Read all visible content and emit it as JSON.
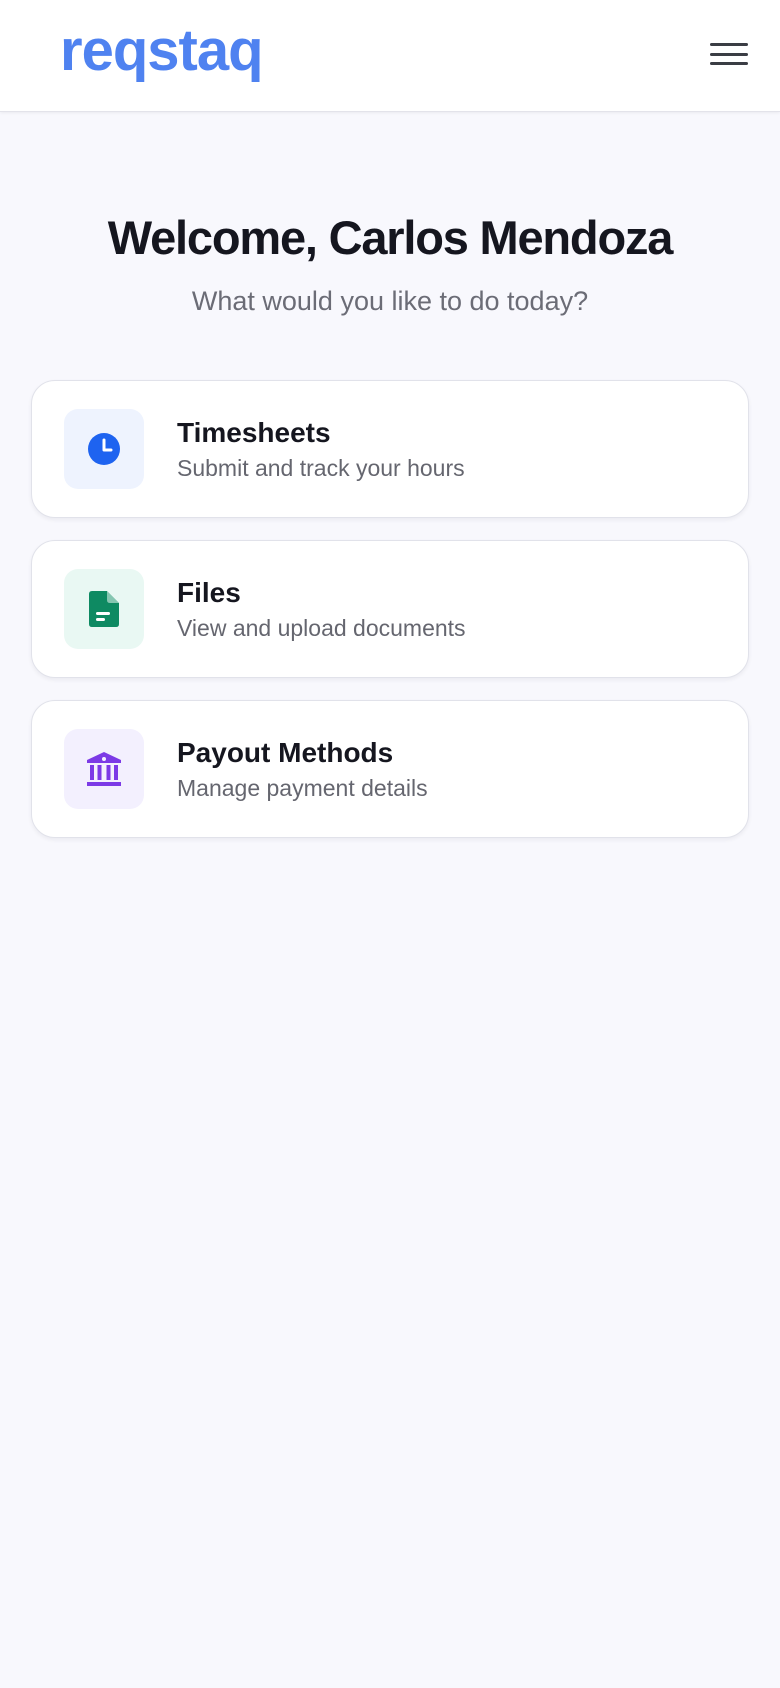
{
  "header": {
    "logo": "reqstaq",
    "menu_icon": "hamburger-menu-icon"
  },
  "welcome": {
    "title": "Welcome, Carlos Mendoza",
    "subtitle": "What would you like to do today?"
  },
  "cards": [
    {
      "title": "Timesheets",
      "description": "Submit and track your hours",
      "icon": "clock-icon",
      "color": "#1e63f0"
    },
    {
      "title": "Files",
      "description": "View and upload documents",
      "icon": "document-icon",
      "color": "#0e8a62"
    },
    {
      "title": "Payout Methods",
      "description": "Manage payment details",
      "icon": "bank-icon",
      "color": "#7c3ae6"
    }
  ],
  "colors": {
    "brand": "#4f82f0",
    "background": "#f8f8fd"
  }
}
